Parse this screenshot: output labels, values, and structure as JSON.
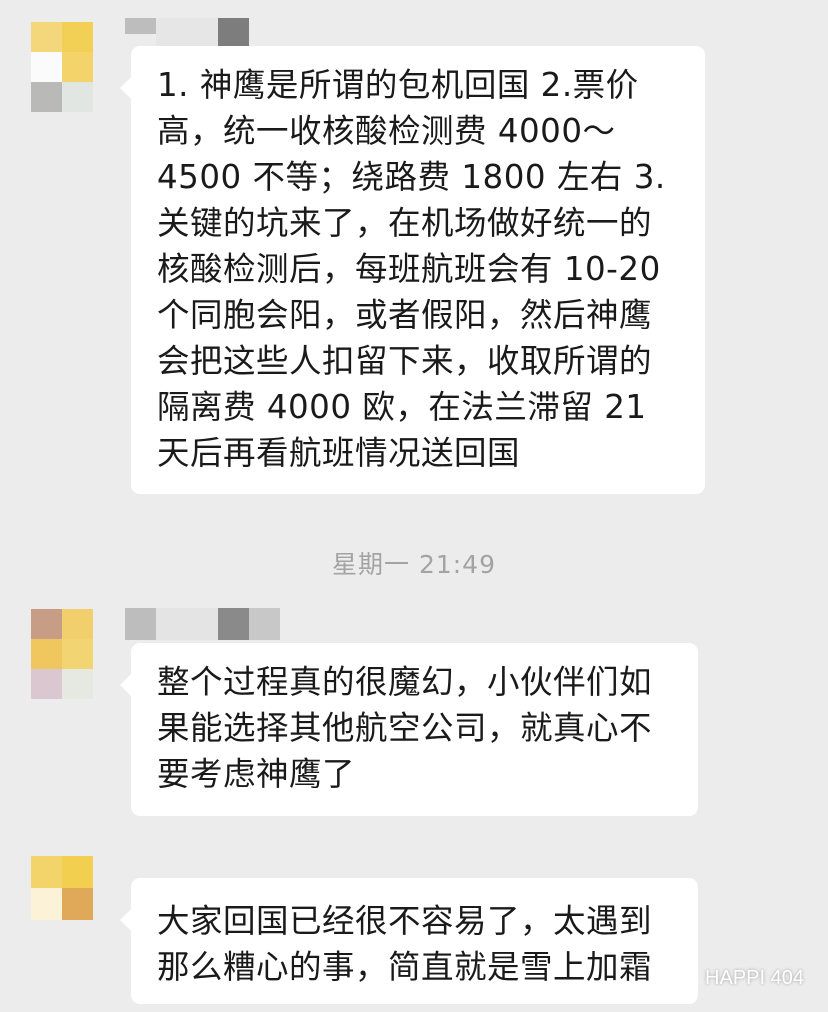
{
  "chat": {
    "messages": [
      {
        "text": "1. 神鹰是所谓的包机回国 2.票价高，统一收核酸检测费 4000～4500 不等；绕路费 1800 左右 3.关键的坑来了，在机场做好统一的核酸检测后，每班航班会有 10-20 个同胞会阳，或者假阳，然后神鹰会把这些人扣留下来，收取所谓的隔离费 4000 欧，在法兰滞留 21 天后再看航班情况送回国"
      },
      {
        "text": "整个过程真的很魔幻，小伙伴们如果能选择其他航空公司，就真心不要考虑神鹰了"
      },
      {
        "text": "大家回国已经很不容易了，太遇到那么糟心的事，简直就是雪上加霜"
      }
    ],
    "timestamp": "星期一 21:49"
  },
  "watermark": {
    "icon": "wechat-icon",
    "text": "HAPPI 404"
  },
  "colors": {
    "background": "#ececec",
    "bubble": "#ffffff",
    "text": "#1a1a1a",
    "timestamp": "#a3a3a3"
  }
}
